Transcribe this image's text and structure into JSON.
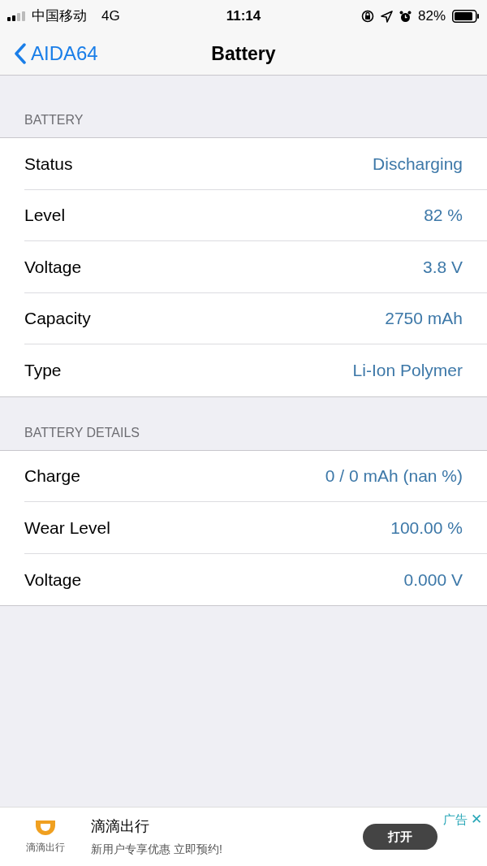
{
  "status_bar": {
    "carrier": "中国移动",
    "network": "4G",
    "time": "11:14",
    "battery_percent": "82%"
  },
  "nav": {
    "back": "AIDA64",
    "title": "Battery"
  },
  "sections": [
    {
      "header": "BATTERY",
      "rows": [
        {
          "label": "Status",
          "value": "Discharging"
        },
        {
          "label": "Level",
          "value": "82 %"
        },
        {
          "label": "Voltage",
          "value": "3.8 V"
        },
        {
          "label": "Capacity",
          "value": "2750 mAh"
        },
        {
          "label": "Type",
          "value": "Li-Ion Polymer"
        }
      ]
    },
    {
      "header": "BATTERY DETAILS",
      "rows": [
        {
          "label": "Charge",
          "value": "0 / 0 mAh (nan %)"
        },
        {
          "label": "Wear Level",
          "value": "100.00 %"
        },
        {
          "label": "Voltage",
          "value": "0.000 V"
        }
      ]
    }
  ],
  "ad": {
    "logo_text": "滴滴出行",
    "title": "滴滴出行",
    "subtitle": "新用户专享优惠 立即预约!",
    "button": "打开",
    "ad_label": "广告",
    "close": "✕"
  }
}
